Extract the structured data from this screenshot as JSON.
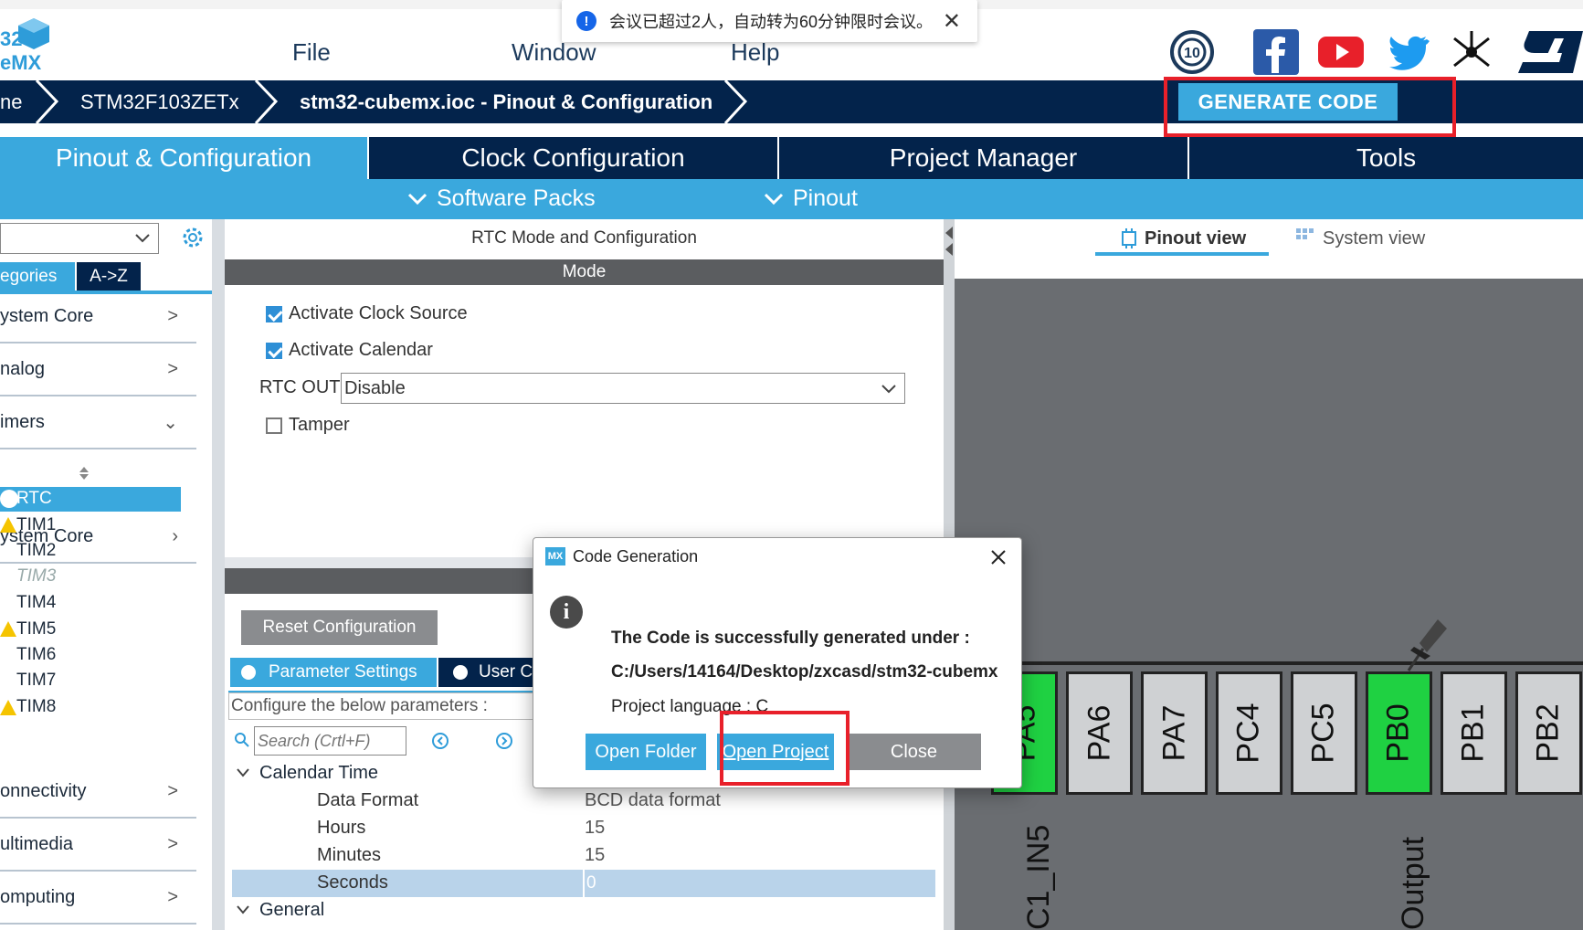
{
  "app": {
    "logo_line1": "32",
    "logo_line2": "eMX"
  },
  "menu": {
    "file": "File",
    "window": "Window",
    "help": "Help"
  },
  "notification": {
    "text": "会议已超过2人，自动转为60分钟限时会议。",
    "close": "✕"
  },
  "breadcrumb": {
    "home": "ne",
    "device": "STM32F103ZETx",
    "project": "stm32-cubemx.ioc - Pinout & Configuration"
  },
  "toolbar": {
    "generate": "GENERATE CODE"
  },
  "tabs": [
    "Pinout & Configuration",
    "Clock Configuration",
    "Project Manager",
    "Tools"
  ],
  "subbar": {
    "software_packs": "Software Packs",
    "pinout": "Pinout"
  },
  "left": {
    "tabs": [
      "egories",
      "A->Z"
    ],
    "categories": [
      {
        "label": "ystem Core"
      },
      {
        "label": "nalog"
      },
      {
        "label": "imers"
      }
    ],
    "timers": [
      "RTC",
      "TIM1",
      "TIM2",
      "TIM3",
      "TIM4",
      "TIM5",
      "TIM6",
      "TIM7",
      "TIM8"
    ],
    "categories2": [
      {
        "label": "onnectivity"
      },
      {
        "label": "ultimedia"
      },
      {
        "label": "omputing"
      }
    ]
  },
  "center": {
    "title": "RTC Mode and Configuration",
    "mode": "Mode",
    "activate_clock": "Activate Clock Source",
    "activate_calendar": "Activate Calendar",
    "rtc_out_label": "RTC OUT",
    "rtc_out_value": "Disable",
    "tamper": "Tamper",
    "reset": "Reset Configuration",
    "param_tab": "Parameter Settings",
    "user_tab": "User C",
    "configure_text": "Configure the below parameters :",
    "search_placeholder": "Search (Crtl+F)",
    "calendar_time": "Calendar Time",
    "params": [
      {
        "name": "Data Format",
        "value": "BCD data format"
      },
      {
        "name": "Hours",
        "value": "15"
      },
      {
        "name": "Minutes",
        "value": "15"
      },
      {
        "name": "Seconds",
        "value": "0"
      }
    ],
    "general": "General"
  },
  "right": {
    "pinout_view": "Pinout view",
    "system_view": "System view",
    "pins": [
      "PA5",
      "PA6",
      "PA7",
      "PC4",
      "PC5",
      "PB0",
      "PB1",
      "PB2"
    ],
    "label_pa5": "C1_IN5",
    "label_pb0": "Output"
  },
  "dialog": {
    "title": "Code Generation",
    "badge": "MX",
    "line1": "The Code is successfully generated under :",
    "line2": "C:/Users/14164/Desktop/zxcasd/stm32-cubemx",
    "line3": "Project language : C",
    "open_folder": "Open Folder",
    "open_project": "Open Project",
    "close": "Close"
  },
  "colors": {
    "navy": "#03234b",
    "accent": "#3aa8dd",
    "green": "#1fd142",
    "red": "#e8202a"
  }
}
